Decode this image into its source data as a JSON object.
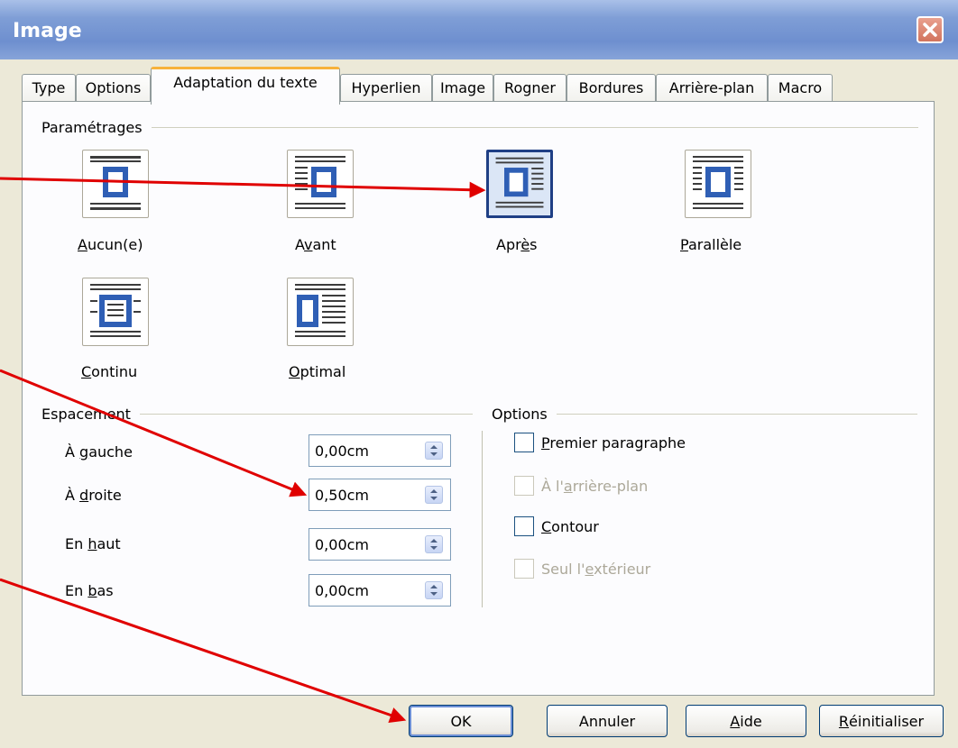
{
  "window": {
    "title": "Image"
  },
  "tabs": [
    {
      "label": "Type"
    },
    {
      "label": "Options"
    },
    {
      "label": "Adaptation du texte",
      "active": true
    },
    {
      "label": "Hyperlien"
    },
    {
      "label": "Image"
    },
    {
      "label": "Rogner"
    },
    {
      "label": "Bordures"
    },
    {
      "label": "Arrière-plan"
    },
    {
      "label": "Macro"
    }
  ],
  "settings": {
    "header": "Paramétrages",
    "options": [
      {
        "label": "Aucun(e)",
        "mnemonic": "A",
        "rest": "ucun(e)",
        "icon": "wrap-none-icon"
      },
      {
        "label": "Avant",
        "pre": "A",
        "mnemonic": "v",
        "rest": "ant",
        "icon": "wrap-before-icon"
      },
      {
        "label": "Après",
        "pre": "Apr",
        "mnemonic": "è",
        "rest": "s",
        "icon": "wrap-after-icon",
        "selected": true
      },
      {
        "label": "Parallèle",
        "mnemonic": "P",
        "rest": "arallèle",
        "icon": "wrap-parallel-icon"
      },
      {
        "label": "Continu",
        "mnemonic": "C",
        "rest": "ontinu",
        "icon": "wrap-through-icon"
      },
      {
        "label": "Optimal",
        "mnemonic": "O",
        "rest": "ptimal",
        "icon": "wrap-optimal-icon"
      }
    ]
  },
  "spacing": {
    "header": "Espacement",
    "fields": [
      {
        "pre": "À ",
        "mnemonic": "g",
        "rest": "auche",
        "value": "0,00cm"
      },
      {
        "pre": "À ",
        "mnemonic": "d",
        "rest": "roite",
        "value": "0,50cm"
      },
      {
        "pre": "En ",
        "mnemonic": "h",
        "rest": "aut",
        "value": "0,00cm"
      },
      {
        "pre": "En ",
        "mnemonic": "b",
        "rest": "as",
        "value": "0,00cm"
      }
    ]
  },
  "options": {
    "header": "Options",
    "checkboxes": [
      {
        "pre": "",
        "mnemonic": "P",
        "rest": "remier paragraphe",
        "checked": false,
        "disabled": false
      },
      {
        "pre": "À l'",
        "mnemonic": "a",
        "rest": "rrière-plan",
        "checked": false,
        "disabled": true
      },
      {
        "pre": "",
        "mnemonic": "C",
        "rest": "ontour",
        "checked": false,
        "disabled": false
      },
      {
        "pre": "Seul l'",
        "mnemonic": "e",
        "rest": "xtérieur",
        "checked": false,
        "disabled": true
      }
    ]
  },
  "buttons": {
    "ok": "OK",
    "cancel": "Annuler",
    "help": {
      "mnemonic": "A",
      "rest": "ide"
    },
    "reset": {
      "mnemonic": "R",
      "rest": "éinitialiser"
    }
  },
  "colors": {
    "accent_tab": "#f7b23b",
    "selected_border": "#1f3f85",
    "annotation_arrow": "#e00000"
  }
}
